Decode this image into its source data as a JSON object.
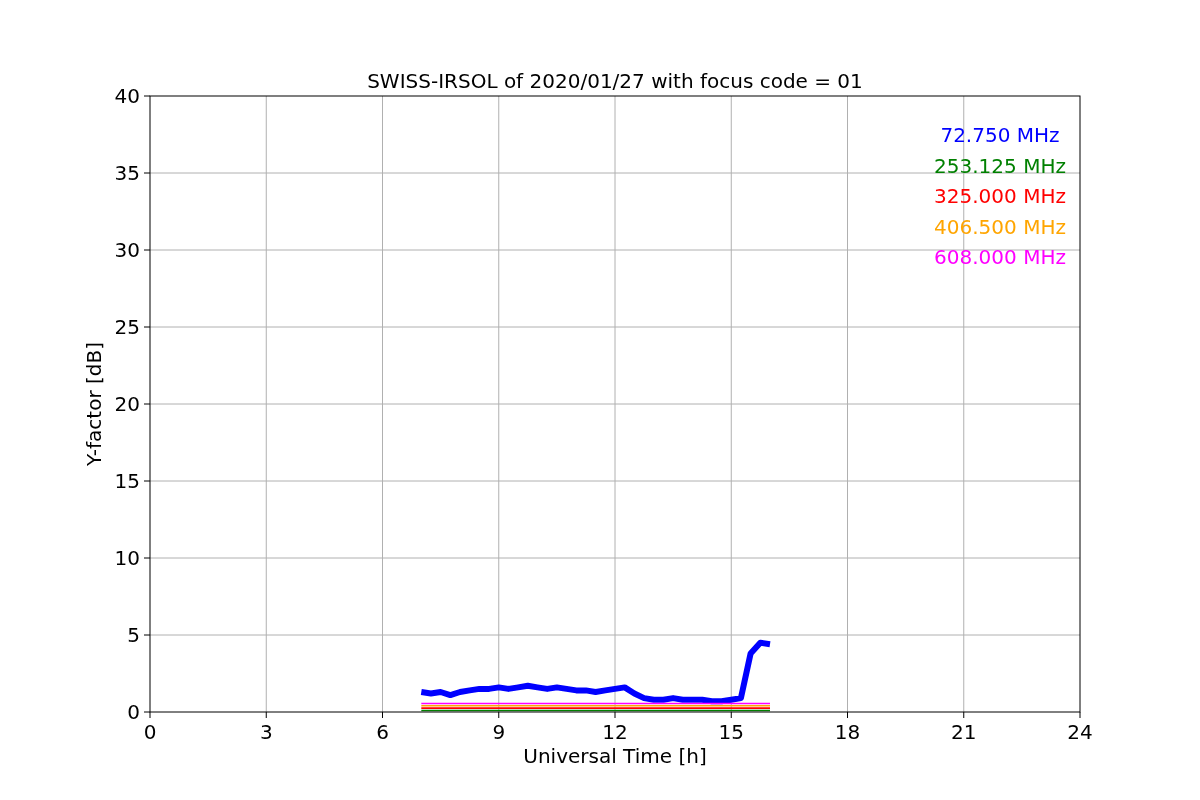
{
  "chart_data": {
    "type": "line",
    "title": "SWISS-IRSOL of 2020/01/27 with focus code = 01",
    "xlabel": "Universal Time [h]",
    "ylabel": "Y-factor [dB]",
    "grid": true,
    "x": [
      7,
      7.25,
      7.5,
      7.75,
      8,
      8.25,
      8.5,
      8.75,
      9,
      9.25,
      9.5,
      9.75,
      10,
      10.25,
      10.5,
      10.75,
      11,
      11.25,
      11.5,
      11.75,
      12,
      12.25,
      12.5,
      12.75,
      13,
      13.25,
      13.5,
      13.75,
      14,
      14.25,
      14.5,
      14.75,
      15,
      15.25,
      15.5,
      15.75,
      16
    ],
    "series": [
      {
        "name": "72.750 MHz",
        "color": "#0000ff",
        "values": [
          1.3,
          1.2,
          1.3,
          1.1,
          1.3,
          1.4,
          1.5,
          1.5,
          1.6,
          1.5,
          1.6,
          1.7,
          1.6,
          1.5,
          1.6,
          1.5,
          1.4,
          1.4,
          1.3,
          1.4,
          1.5,
          1.6,
          1.2,
          0.9,
          0.8,
          0.8,
          0.9,
          0.8,
          0.8,
          0.8,
          0.7,
          0.7,
          0.8,
          0.9,
          3.8,
          4.5,
          4.4
        ]
      },
      {
        "name": "253.125 MHz",
        "color": "#008000",
        "values": [
          0.1,
          0.1,
          0.1,
          0.1,
          0.1,
          0.1,
          0.1,
          0.1,
          0.1,
          0.1,
          0.1,
          0.1,
          0.1,
          0.1,
          0.1,
          0.1,
          0.1,
          0.1,
          0.1,
          0.1,
          0.1,
          0.1,
          0.1,
          0.1,
          0.1,
          0.1,
          0.1,
          0.1,
          0.1,
          0.1,
          0.1,
          0.1,
          0.1,
          0.1,
          0.1,
          0.1,
          0.1
        ]
      },
      {
        "name": "325.000 MHz",
        "color": "#ff0000",
        "values": [
          0.25,
          0.25,
          0.25,
          0.25,
          0.25,
          0.25,
          0.25,
          0.25,
          0.25,
          0.25,
          0.25,
          0.25,
          0.25,
          0.25,
          0.25,
          0.25,
          0.25,
          0.25,
          0.25,
          0.25,
          0.25,
          0.25,
          0.25,
          0.25,
          0.25,
          0.25,
          0.25,
          0.25,
          0.25,
          0.25,
          0.25,
          0.25,
          0.25,
          0.25,
          0.25,
          0.25,
          0.25
        ]
      },
      {
        "name": "406.500 MHz",
        "color": "#ffa500",
        "values": [
          0.4,
          0.4,
          0.4,
          0.4,
          0.4,
          0.4,
          0.4,
          0.4,
          0.4,
          0.4,
          0.4,
          0.4,
          0.4,
          0.4,
          0.4,
          0.4,
          0.4,
          0.4,
          0.4,
          0.4,
          0.4,
          0.4,
          0.4,
          0.4,
          0.4,
          0.4,
          0.4,
          0.4,
          0.4,
          0.4,
          0.4,
          0.4,
          0.4,
          0.4,
          0.4,
          0.4,
          0.4
        ]
      },
      {
        "name": "608.000 MHz",
        "color": "#ff00ff",
        "values": [
          0.55,
          0.55,
          0.55,
          0.55,
          0.55,
          0.55,
          0.55,
          0.55,
          0.55,
          0.55,
          0.55,
          0.55,
          0.55,
          0.55,
          0.55,
          0.55,
          0.55,
          0.55,
          0.55,
          0.55,
          0.55,
          0.55,
          0.55,
          0.55,
          0.55,
          0.55,
          0.55,
          0.55,
          0.55,
          0.55,
          0.55,
          0.55,
          0.55,
          0.55,
          0.55,
          0.55,
          0.55
        ]
      }
    ],
    "xlim": [
      0,
      24
    ],
    "ylim": [
      0,
      40
    ],
    "xticks": [
      0,
      3,
      6,
      9,
      12,
      15,
      18,
      21,
      24
    ],
    "yticks": [
      0,
      5,
      10,
      15,
      20,
      25,
      30,
      35,
      40
    ]
  }
}
